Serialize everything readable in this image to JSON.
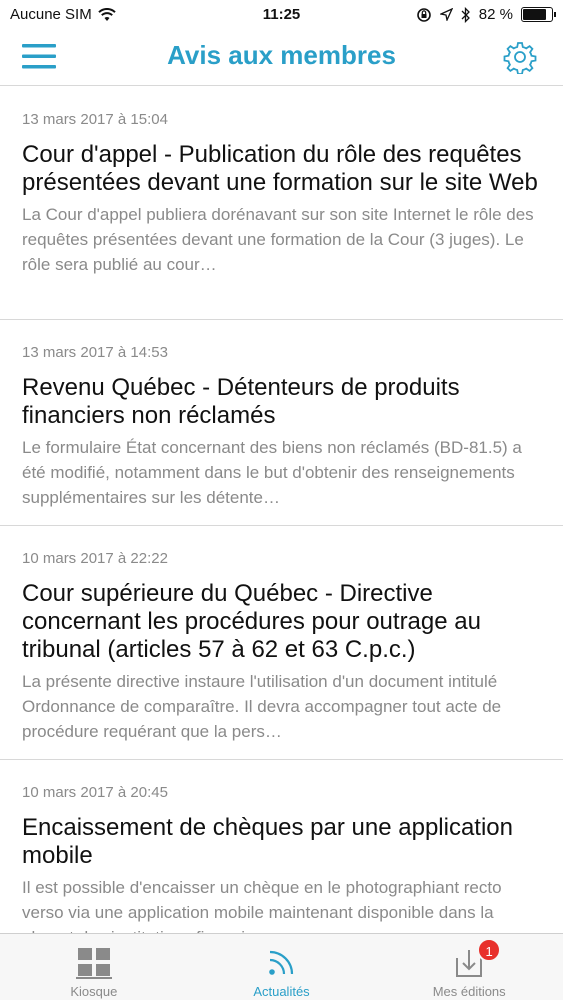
{
  "status_bar": {
    "carrier": "Aucune SIM",
    "time": "11:25",
    "battery_percent": "82 %",
    "battery_level": 0.82
  },
  "header": {
    "title": "Avis aux membres",
    "menu_icon": "hamburger-menu-icon",
    "settings_icon": "gear-icon"
  },
  "articles": [
    {
      "date": "13 mars 2017 à 15:04",
      "title": "Cour d'appel - Publication du rôle des requêtes présentées devant une formation sur le site Web",
      "excerpt": "La Cour d'appel publiera dorénavant sur son site Internet le rôle des requêtes présentées devant une formation de la Cour (3 juges). Le rôle sera publié au cour…"
    },
    {
      "date": "13 mars 2017 à 14:53",
      "title": "Revenu Québec - Détenteurs de produits financiers non réclamés",
      "excerpt": "Le formulaire État concernant des biens non réclamés (BD-81.5) a été modifié, notamment dans le but d'obtenir des renseignements supplémentaires sur les détente…"
    },
    {
      "date": "10 mars 2017 à 22:22",
      "title": "Cour supérieure du Québec - Directive concernant les procédures pour outrage au tribunal (articles 57 à 62 et 63 C.p.c.)",
      "excerpt": "La présente directive instaure l'utilisation d'un document intitulé Ordonnance de comparaître. Il devra accompagner tout acte de procédure requérant que la pers…"
    },
    {
      "date": "10 mars 2017 à 20:45",
      "title": "Encaissement de chèques par une application mobile",
      "excerpt": "Il est possible d'encaisser un chèque en le photographiant recto verso via une application mobile maintenant disponible dans la plupart des institutions financi…"
    }
  ],
  "tabs": [
    {
      "label": "Kiosque",
      "icon": "kiosk-grid-icon",
      "active": false
    },
    {
      "label": "Actualités",
      "icon": "rss-feed-icon",
      "active": true
    },
    {
      "label": "Mes éditions",
      "icon": "download-tray-icon",
      "active": false,
      "badge": "1"
    }
  ],
  "colors": {
    "accent": "#2a9fc8",
    "badge": "#e8302b",
    "muted_text": "#8a8a8a"
  }
}
